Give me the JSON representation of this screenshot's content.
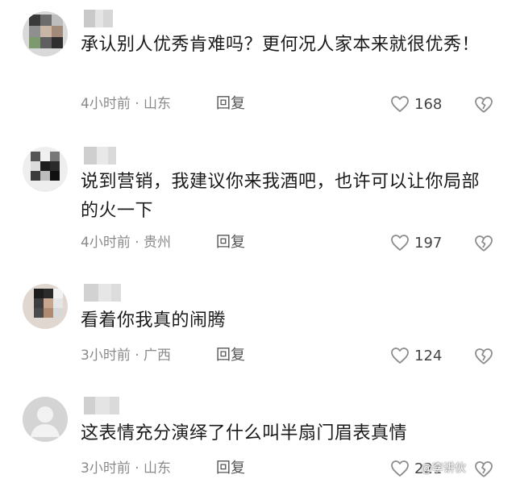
{
  "comments": [
    {
      "text": "承认别人优秀肯难吗？更何况人家本来就很优秀！",
      "time": "4小时前",
      "location": "山东",
      "separator": "·",
      "reply": "回复",
      "likes": "168",
      "avatar_style": "photo"
    },
    {
      "text": "说到营销，我建议你来我酒吧，也许可以让你局部的火一下",
      "time": "4小时前",
      "location": "贵州",
      "separator": "·",
      "reply": "回复",
      "likes": "197",
      "avatar_style": "photo"
    },
    {
      "text": "看着你我真的闹腾",
      "time": "3小时前",
      "location": "广西",
      "separator": "·",
      "reply": "回复",
      "likes": "124",
      "avatar_style": "photo"
    },
    {
      "text": "这表情充分演绎了什么叫半扇门眉表真情",
      "time": "3小时前",
      "location": "山东",
      "separator": "·",
      "reply": "回复",
      "likes": "221",
      "avatar_style": "default"
    }
  ],
  "watermark": "@李讲伙",
  "icons": {
    "like": "heart-outline-icon",
    "dislike": "broken-heart-icon"
  },
  "colors": {
    "meta_text": "#8a8a8a",
    "body_text": "#1a1a1a",
    "icon": "#9a9a9a"
  }
}
